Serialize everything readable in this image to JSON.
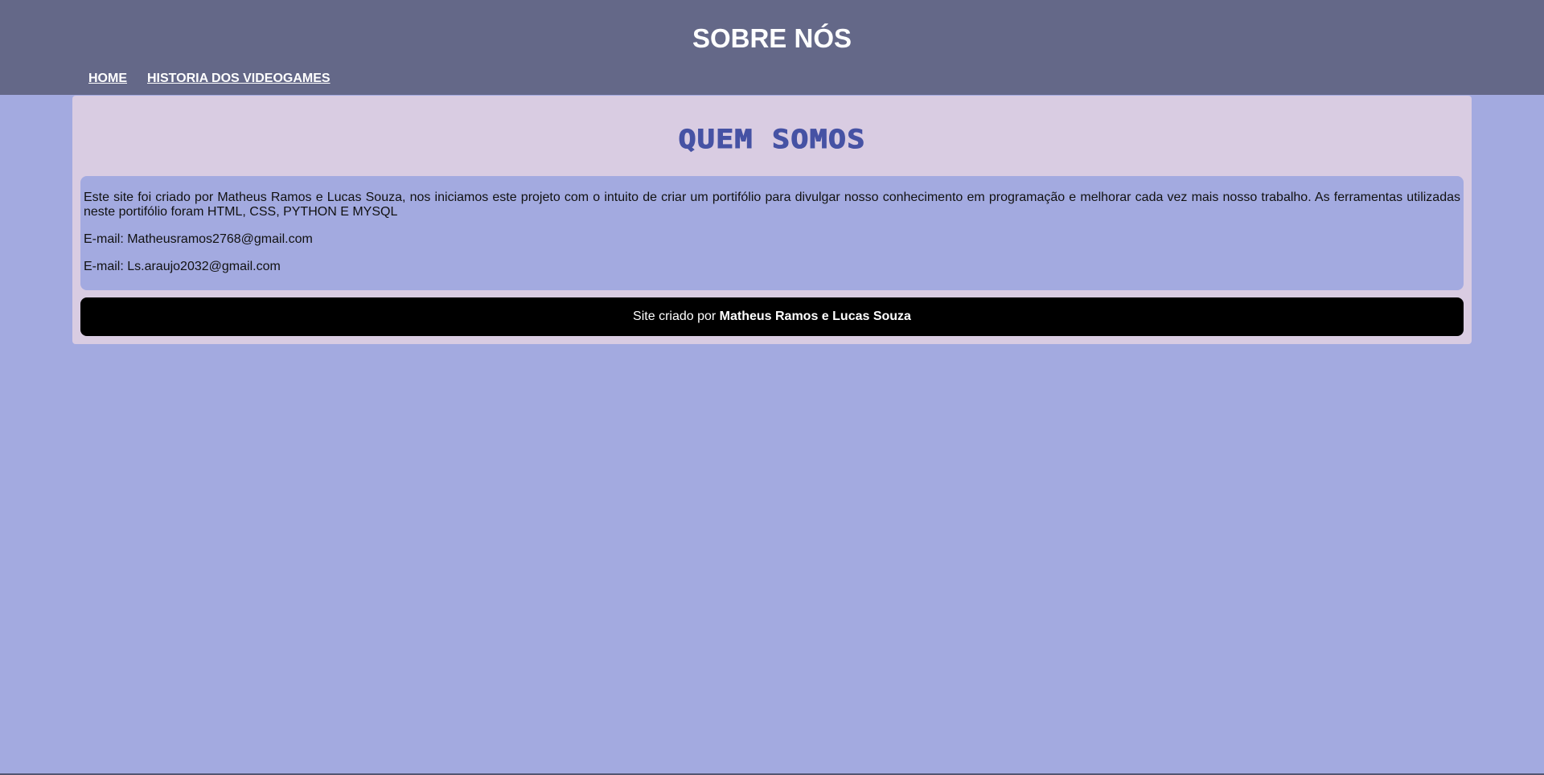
{
  "header": {
    "title": "SOBRE NÓS",
    "nav": [
      {
        "label": "HOME"
      },
      {
        "label": "HISTORIA DOS VIDEOGAMES"
      }
    ]
  },
  "main": {
    "heading": "QUEM SOMOS",
    "description": "Este site foi criado por Matheus Ramos e Lucas Souza, nos iniciamos este projeto com o intuito de criar um portifólio para divulgar nosso conhecimento em programação e melhorar cada vez mais nosso trabalho. As ferramentas utilizadas neste portifólio foram HTML, CSS, PYTHON E MYSQL",
    "emails": [
      "E-mail: Matheusramos2768@gmail.com",
      "E-mail: Ls.araujo2032@gmail.com"
    ]
  },
  "footer": {
    "prefix": "Site criado por ",
    "authors": "Matheus Ramos e Lucas Souza"
  },
  "colors": {
    "page_background": "#a3aae0",
    "header_background": "#646888",
    "panel_background": "#d9cce2",
    "heading_color": "#4652a4",
    "footer_background": "#000000"
  }
}
